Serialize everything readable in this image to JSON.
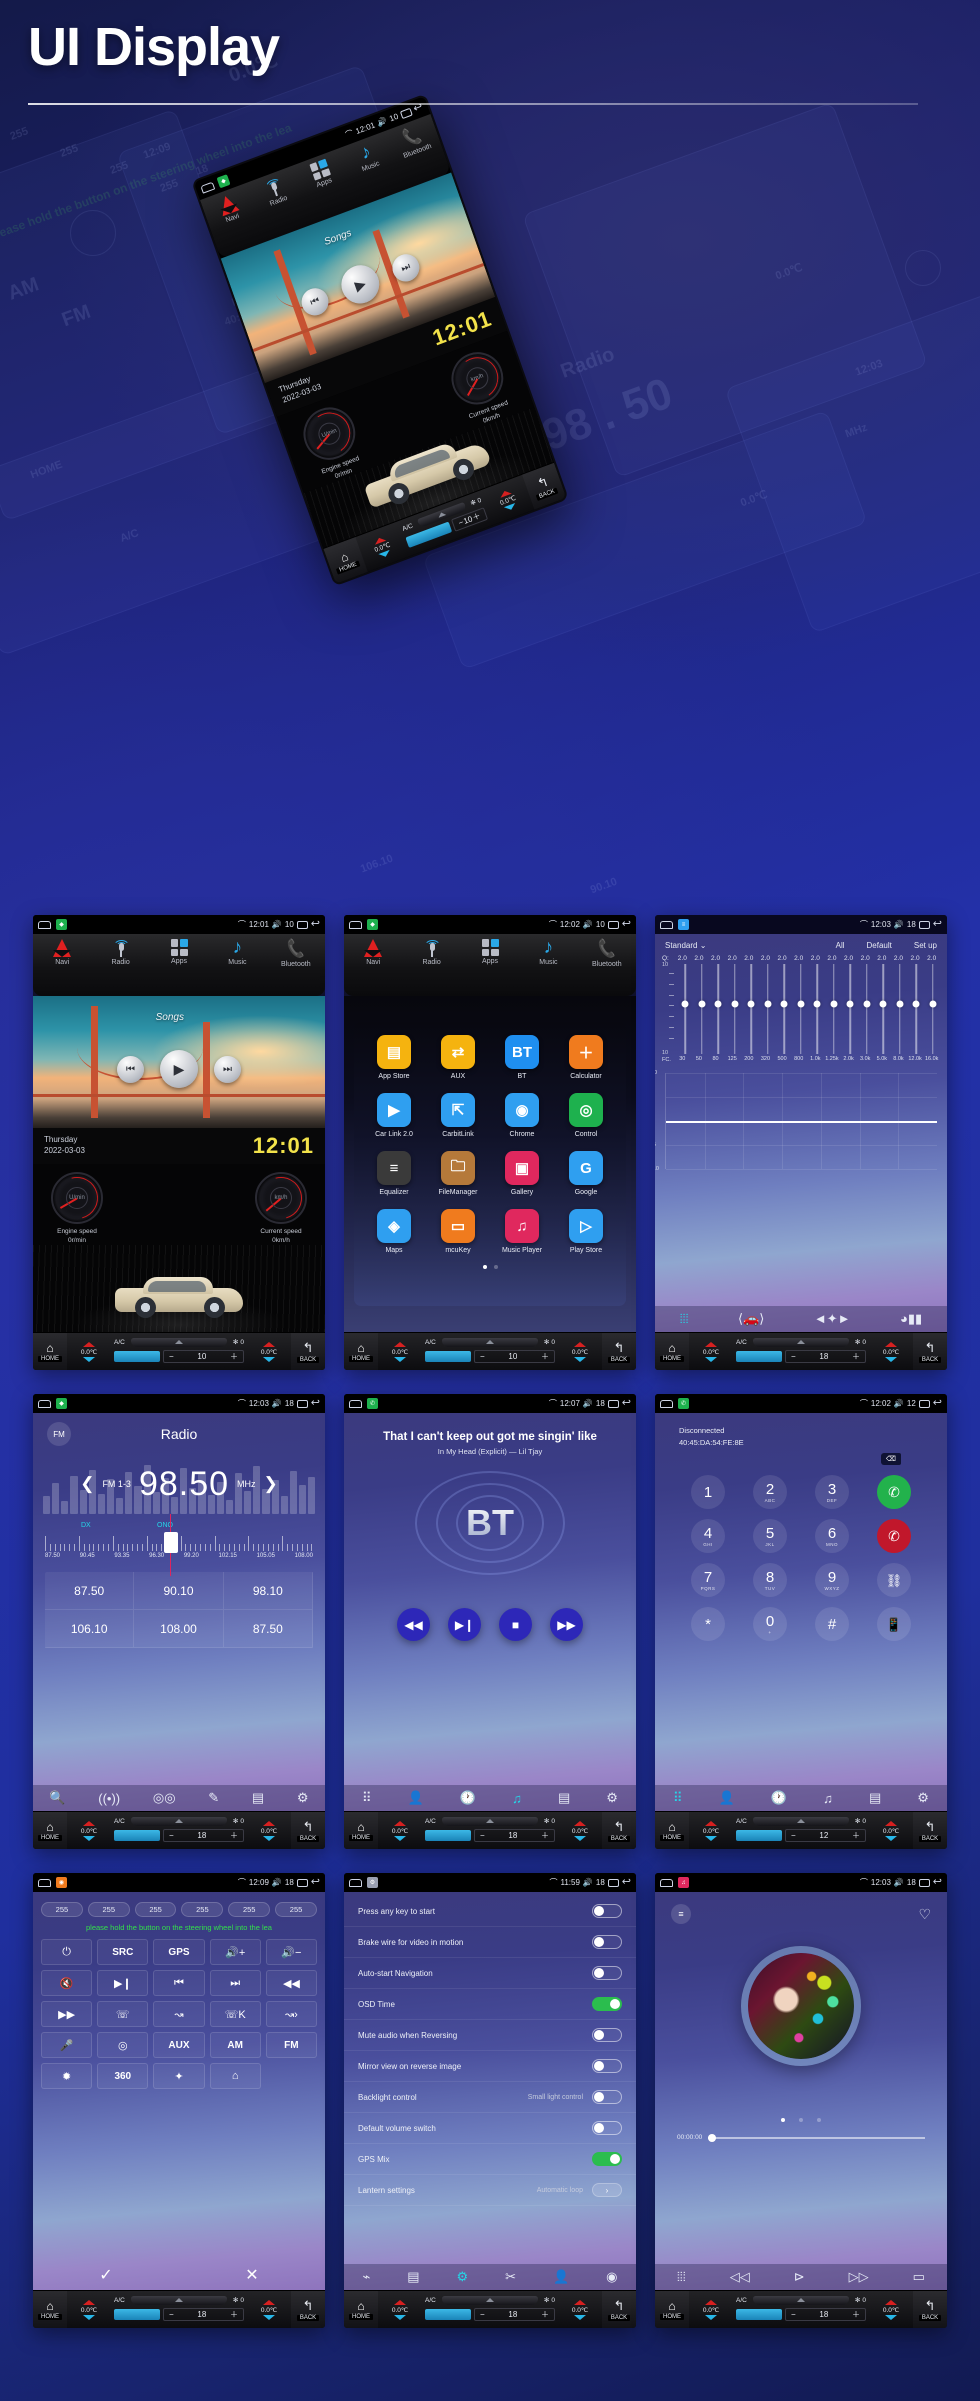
{
  "page": {
    "title": "UI Display"
  },
  "hero": {
    "status": {
      "time": "12:01",
      "volume": "10"
    },
    "nav": [
      "Navi",
      "Radio",
      "Apps",
      "Music",
      "Bluetooth"
    ],
    "songs_label": "Songs",
    "date_day": "Thursday",
    "date": "2022-03-03",
    "clock": "12:01",
    "engine_label": "Engine speed",
    "engine_value": "0r/min",
    "engine_unit": "U/min",
    "speed_label": "Current speed",
    "speed_value": "0km/h",
    "speed_unit": "km/h",
    "hvac": {
      "home": "HOME",
      "back": "BACK",
      "temp_left": "0.0℃",
      "temp_right": "0.0℃",
      "ac": "A/C",
      "fan": "0",
      "level": "10"
    }
  },
  "hvac_common": {
    "home": "HOME",
    "back": "BACK",
    "temp_left": "0.0℃",
    "temp_right": "0.0℃",
    "ac": "A/C",
    "fan": "0"
  },
  "screens": [
    {
      "id": "home",
      "status": {
        "time": "12:01",
        "volume": "10"
      },
      "nav": [
        "Navi",
        "Radio",
        "Apps",
        "Music",
        "Bluetooth"
      ],
      "songs_label": "Songs",
      "date_day": "Thursday",
      "date": "2022-03-03",
      "clock": "12:01",
      "engine_label": "Engine speed",
      "engine_value": "0r/min",
      "engine_unit": "U/min",
      "speed_label": "Current speed",
      "speed_value": "0km/h",
      "speed_unit": "km/h",
      "hvac_level": "10"
    },
    {
      "id": "apps",
      "status": {
        "time": "12:02",
        "volume": "10"
      },
      "nav": [
        "Navi",
        "Radio",
        "Apps",
        "Music",
        "Bluetooth"
      ],
      "apps": [
        {
          "label": "App Store",
          "glyph": "▤",
          "color": "#f5b30f"
        },
        {
          "label": "AUX",
          "glyph": "⇄",
          "color": "#f5b30f"
        },
        {
          "label": "BT",
          "glyph": "BT",
          "color": "#1f8ff0"
        },
        {
          "label": "Calculator",
          "glyph": "＋",
          "color": "#f07b1e"
        },
        {
          "label": "Car Link 2.0",
          "glyph": "▶",
          "color": "#2f9ff0"
        },
        {
          "label": "CarbitLink",
          "glyph": "⇱",
          "color": "#2f9ff0"
        },
        {
          "label": "Chrome",
          "glyph": "◉",
          "color": "#2f9ff0"
        },
        {
          "label": "Control",
          "glyph": "◎",
          "color": "#1eb14e"
        },
        {
          "label": "Equalizer",
          "glyph": "≡",
          "color": "#3a3a3a"
        },
        {
          "label": "FileManager",
          "glyph": "🗀",
          "color": "#b5793a"
        },
        {
          "label": "Gallery",
          "glyph": "▣",
          "color": "#e0285e"
        },
        {
          "label": "Google",
          "glyph": "G",
          "color": "#2f9ff0"
        },
        {
          "label": "Maps",
          "glyph": "◈",
          "color": "#2f9ff0"
        },
        {
          "label": "mcuKey",
          "glyph": "▭",
          "color": "#f07b1e"
        },
        {
          "label": "Music Player",
          "glyph": "♫",
          "color": "#e0285e"
        },
        {
          "label": "Play Store",
          "glyph": "▷",
          "color": "#2f9ff0"
        }
      ],
      "hvac_level": "10"
    },
    {
      "id": "equalizer",
      "status": {
        "time": "12:03",
        "volume": "18"
      },
      "preset": "Standard",
      "actions": [
        "All",
        "Default",
        "Set up"
      ],
      "q_label": "Q:",
      "q_values": [
        "2.0",
        "2.0",
        "2.0",
        "2.0",
        "2.0",
        "2.0",
        "2.0",
        "2.0",
        "2.0",
        "2.0",
        "2.0",
        "2.0",
        "2.0",
        "2.0",
        "2.0",
        "2.0"
      ],
      "fc_label": "FC.",
      "fc_values": [
        "30",
        "50",
        "80",
        "125",
        "200",
        "320",
        "500",
        "800",
        "1.0k",
        "1.25k",
        "2.0k",
        "3.0k",
        "5.0k",
        "8.0k",
        "12.0k",
        "16.0k"
      ],
      "axis_top": "10",
      "axis_bottom": "10",
      "curve_ticks": [
        "10",
        "5",
        "0",
        "-5",
        "-10"
      ],
      "tabs": [
        "equalizer-icon",
        "car-audio-icon",
        "balance-icon",
        "volume-icon"
      ],
      "hvac_level": "18"
    },
    {
      "id": "radio",
      "status": {
        "time": "12:03",
        "volume": "18"
      },
      "band_badge": "FM",
      "title": "Radio",
      "band": "FM 1-3",
      "frequency": "98.50",
      "unit": "MHz",
      "dx": "DX",
      "stereo": "ONO",
      "scale_labels": [
        "87.50",
        "90.45",
        "93.35",
        "96.30",
        "99.20",
        "102.15",
        "105.05",
        "108.00"
      ],
      "presets": [
        "87.50",
        "90.10",
        "98.10",
        "106.10",
        "108.00",
        "87.50"
      ],
      "tools": [
        "search-icon",
        "scan-icon",
        "stereo-icon",
        "edit-icon",
        "save-icon",
        "settings-icon"
      ],
      "hvac_level": "18"
    },
    {
      "id": "bluetooth-music",
      "status": {
        "time": "12:07",
        "volume": "18"
      },
      "lyric": "That I can't keep out got me singin' like",
      "track": "In My Head (Explicit) — Lil Tjay",
      "logo": "BT",
      "controls": [
        "◀◀",
        "▶❙",
        "■",
        "▶▶"
      ],
      "tabs": [
        "dialpad-icon",
        "contacts-icon",
        "history-icon",
        "music-icon",
        "sync-icon",
        "settings-icon"
      ],
      "hvac_level": "18"
    },
    {
      "id": "dialpad",
      "status": {
        "time": "12:02",
        "volume": "12"
      },
      "state": "Disconnected",
      "mac": "40:45:DA:54:FE:8E",
      "keys": [
        {
          "num": "1",
          "ltr": ""
        },
        {
          "num": "2",
          "ltr": "ABC"
        },
        {
          "num": "3",
          "ltr": "DEF"
        },
        {
          "num": "call",
          "ltr": ""
        },
        {
          "num": "4",
          "ltr": "GHI"
        },
        {
          "num": "5",
          "ltr": "JKL"
        },
        {
          "num": "6",
          "ltr": "MNO"
        },
        {
          "num": "end",
          "ltr": ""
        },
        {
          "num": "7",
          "ltr": "PQRS"
        },
        {
          "num": "8",
          "ltr": "TUV"
        },
        {
          "num": "9",
          "ltr": "WXYZ"
        },
        {
          "num": "link",
          "ltr": ""
        },
        {
          "num": "*",
          "ltr": ""
        },
        {
          "num": "0",
          "ltr": "+"
        },
        {
          "num": "#",
          "ltr": ""
        },
        {
          "num": "transfer",
          "ltr": ""
        }
      ],
      "tabs": [
        "dialpad-icon",
        "contacts-icon",
        "history-icon",
        "music-icon",
        "sync-icon",
        "settings-icon"
      ],
      "hvac_level": "12"
    },
    {
      "id": "steering-wheel-control",
      "status": {
        "time": "12:09",
        "volume": "18"
      },
      "chips": [
        "255",
        "255",
        "255",
        "255",
        "255",
        "255"
      ],
      "note": "please hold the button on the steering wheel into the lea",
      "buttons": [
        "⏻",
        "SRC",
        "GPS",
        "🔊+",
        "🔊−",
        "🔇",
        "▶❙",
        "⏮",
        "⏭",
        "◀◀",
        "▶▶",
        "☏",
        "↝",
        "☏K",
        "↝›",
        "🎤",
        "◎",
        "AUX",
        "AM",
        "FM",
        "✹",
        "360",
        "✦",
        "⌂"
      ],
      "confirm": "✓",
      "cancel": "✕",
      "hvac_level": "18"
    },
    {
      "id": "settings",
      "status": {
        "time": "11:59",
        "volume": "18"
      },
      "rows": [
        {
          "label": "Press any key to start",
          "value": "",
          "toggle": "off"
        },
        {
          "label": "Brake wire for video in motion",
          "value": "",
          "toggle": "off"
        },
        {
          "label": "Auto-start Navigation",
          "value": "",
          "toggle": "off"
        },
        {
          "label": "OSD Time",
          "value": "",
          "toggle": "on"
        },
        {
          "label": "Mute audio when Reversing",
          "value": "",
          "toggle": "off"
        },
        {
          "label": "Mirror view on reverse image",
          "value": "",
          "toggle": "off"
        },
        {
          "label": "Backlight control",
          "value": "Small light control",
          "toggle": "off"
        },
        {
          "label": "Default volume switch",
          "value": "",
          "toggle": "off"
        },
        {
          "label": "GPS Mix",
          "value": "",
          "toggle": "on"
        },
        {
          "label": "Lantern settings",
          "value": "Automatic loop",
          "toggle": "arrow"
        }
      ],
      "tabs": [
        "wifi-icon",
        "device-icon",
        "settings-icon",
        "tools-icon",
        "user-icon",
        "factory-icon"
      ],
      "hvac_level": "18"
    },
    {
      "id": "music-player",
      "status": {
        "time": "12:03",
        "volume": "18"
      },
      "elapsed": "00:00:00",
      "controls": [
        "equalizer-icon",
        "prev-icon",
        "play-icon",
        "next-icon",
        "repeat-icon"
      ],
      "hvac_level": "18"
    }
  ],
  "ghost_texts": {
    "radio": "Radio",
    "freq": "98 . 50",
    "am": "AM",
    "fm": "FM",
    "mhz": "MHz",
    "home": "HOME",
    "back": "BACK",
    "temp": "0.0℃",
    "ac": "A/C",
    "swc_note": "please hold the button on the steering wheel into the lea",
    "chip": "255",
    "disconnected": "Disconnected",
    "mac": "40:45:DA:54:FE:8E",
    "time1": "12:09",
    "time2": "12:03",
    "time3": "12:02",
    "vol": "18",
    "band": "FM 1-3",
    "lvl": "10",
    "preset1": "106.10",
    "preset2": "90.10"
  }
}
